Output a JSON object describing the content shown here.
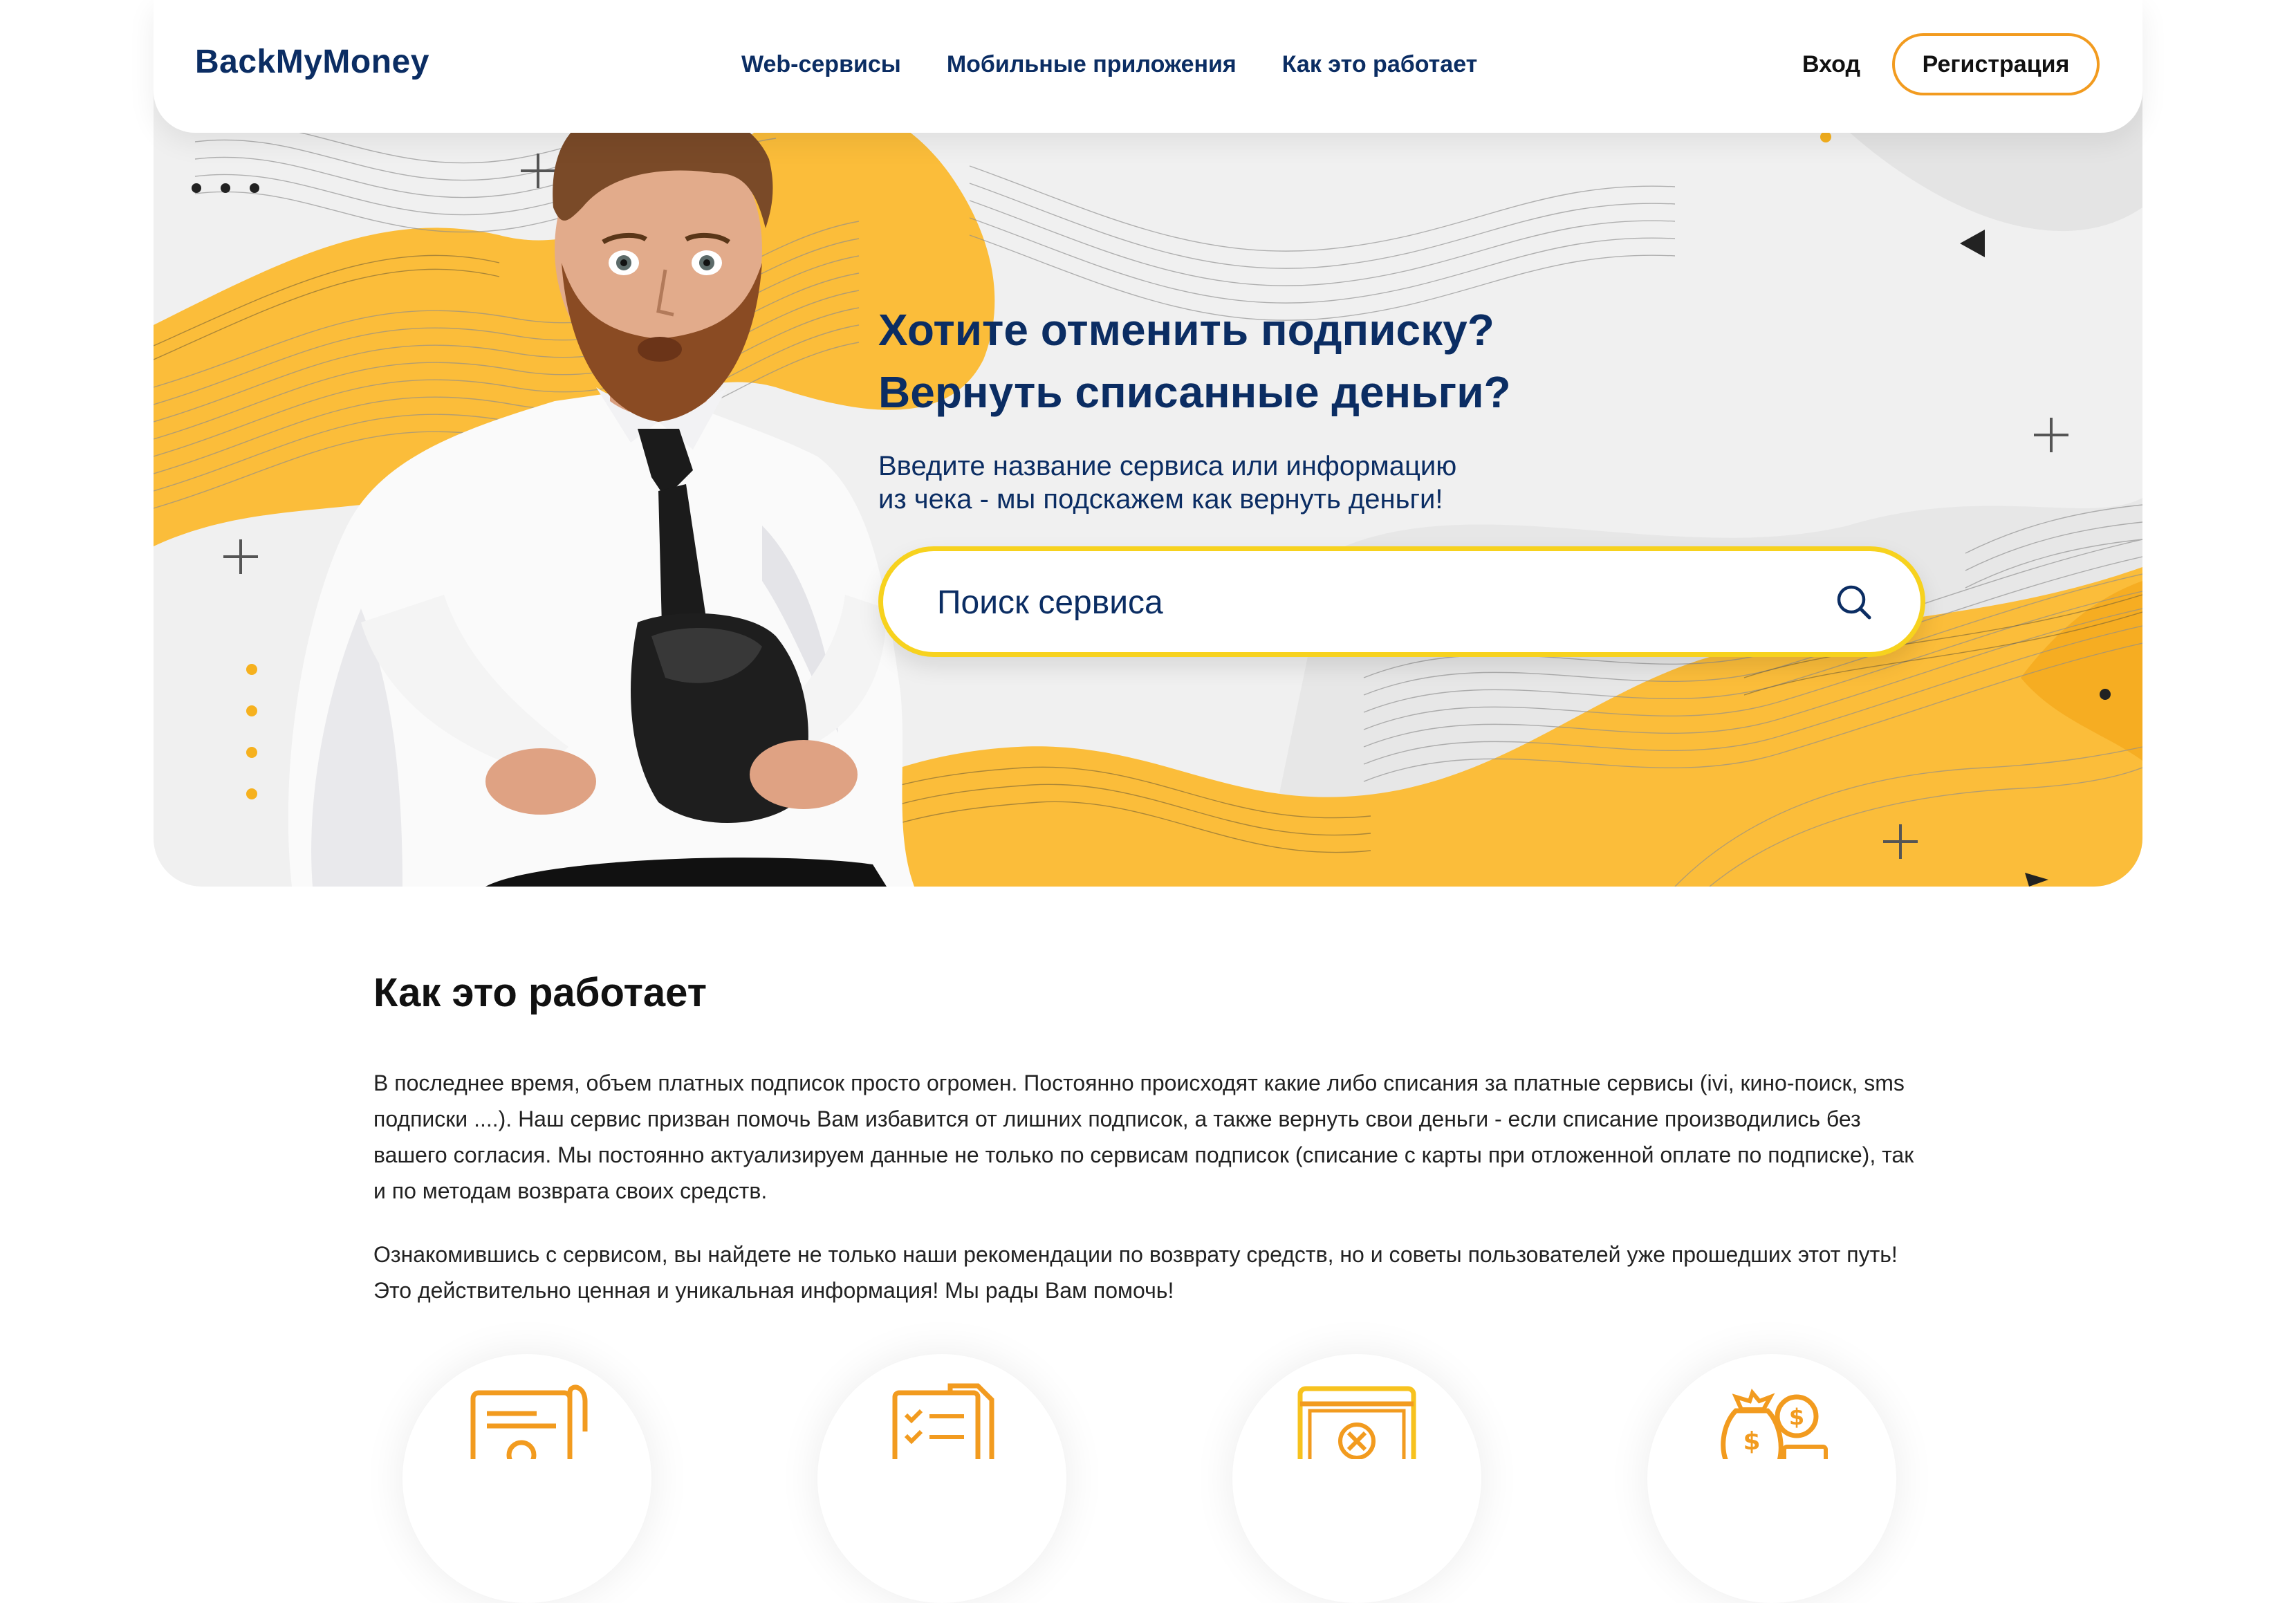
{
  "header": {
    "logo": "BackMyMoney",
    "nav": [
      "Web-сервисы",
      "Мобильные приложения",
      "Как это работает"
    ],
    "login": "Вход",
    "register": "Регистрация"
  },
  "hero": {
    "title_line1": "Хотите отменить подписку?",
    "title_line2": "Вернуть списанные деньги?",
    "subtitle_line1": "Введите название сервиса или информацию",
    "subtitle_line2": "из чека - мы подскажем как вернуть деньги!",
    "search_placeholder": "Поиск сервиса"
  },
  "how": {
    "title": "Как это работает",
    "paragraph1": "В последнее время, объем платных подписок просто огромен. Постоянно происходят какие либо списания за платные сервисы (ivi, кино-поиск, sms подписки ....). Наш сервис призван помочь Вам избавится от лишних подписок, а также вернуть свои деньги - если списание производились без вашего согласия. Мы постоянно актуализируем данные не только по сервисам подписок (списание с карты при отложенной оплате по подписке), так и по методам возврата своих средств.",
    "paragraph2": "Ознакомившись с сервисом, вы найдете не только наши рекомендации по возврату средств, но и советы пользователей уже прошедших этот путь! Это действительно ценная и уникальная информация! Мы рады Вам помочь!"
  },
  "colors": {
    "accent_orange": "#f29b1f",
    "accent_yellow": "#f7d21e",
    "wave_yellow": "#fbbd3a",
    "navy": "#0b2d63"
  },
  "icons": [
    "document-coin-icon",
    "checklist-icon",
    "browser-cancel-icon",
    "money-bag-icon"
  ]
}
